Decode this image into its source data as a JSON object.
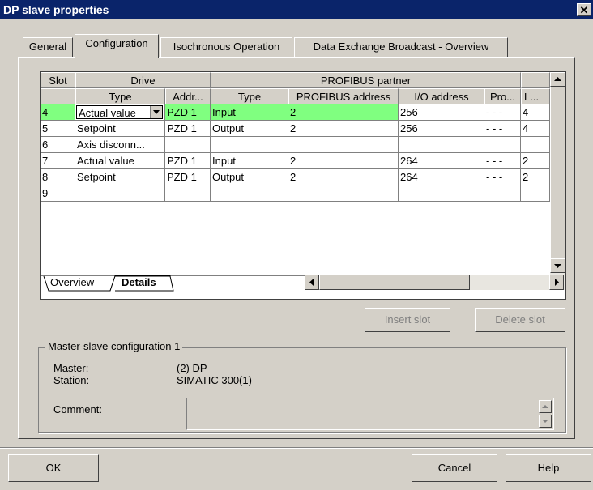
{
  "window": {
    "title": "DP slave properties",
    "close_glyph": "✕"
  },
  "tabs": [
    "General",
    "Configuration",
    "Isochronous Operation",
    "Data Exchange Broadcast - Overview"
  ],
  "table": {
    "group_headers": {
      "slot": "Slot",
      "drive": "Drive",
      "partner": "PROFIBUS partner"
    },
    "columns": [
      "Type",
      "Addr...",
      "Type",
      "PROFIBUS address",
      "I/O address",
      "Pro...",
      "L..."
    ],
    "rows": [
      {
        "slot": "4",
        "drive_type": "Actual value",
        "addr": "PZD 1",
        "type": "Input",
        "profibus": "2",
        "io": "256",
        "pro": "- - -",
        "len": "4",
        "selected": true
      },
      {
        "slot": "5",
        "drive_type": "Setpoint",
        "addr": "PZD 1",
        "type": "Output",
        "profibus": "2",
        "io": "256",
        "pro": "- - -",
        "len": "4"
      },
      {
        "slot": "6",
        "drive_type": "Axis disconn...",
        "addr": "",
        "type": "",
        "profibus": "",
        "io": "",
        "pro": "",
        "len": ""
      },
      {
        "slot": "7",
        "drive_type": "Actual value",
        "addr": "PZD 1",
        "type": "Input",
        "profibus": "2",
        "io": "264",
        "pro": "- - -",
        "len": "2"
      },
      {
        "slot": "8",
        "drive_type": "Setpoint",
        "addr": "PZD 1",
        "type": "Output",
        "profibus": "2",
        "io": "264",
        "pro": "- - -",
        "len": "2"
      },
      {
        "slot": "9",
        "drive_type": "",
        "addr": "",
        "type": "",
        "profibus": "",
        "io": "",
        "pro": "",
        "len": ""
      }
    ],
    "bottom_tabs": [
      "Overview",
      "Details"
    ]
  },
  "buttons": {
    "insert_slot": "Insert slot",
    "delete_slot": "Delete slot",
    "ok": "OK",
    "cancel": "Cancel",
    "help": "Help"
  },
  "master_slave": {
    "group_title": "Master-slave configuration 1",
    "master_label": "Master:",
    "master_value": "(2) DP",
    "station_label": "Station:",
    "station_value": "SIMATIC 300(1)",
    "comment_label": "Comment:",
    "comment_value": ""
  },
  "colors": {
    "selected_row": "#80ff80",
    "titlebar": "#0a246a",
    "dialog": "#d4d0c8"
  }
}
